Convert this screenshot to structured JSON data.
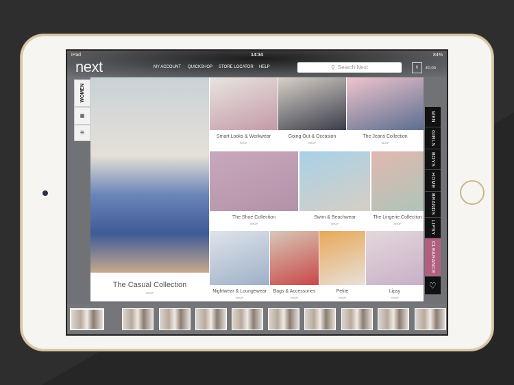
{
  "status": {
    "device": "iPad",
    "time": "14:34",
    "battery": "84%"
  },
  "header": {
    "logo": "next",
    "nav": [
      "MY ACCOUNT",
      "QUICKSHOP",
      "STORE LOCATOR",
      "HELP"
    ],
    "search_placeholder": "Search Next",
    "bag_count": "0",
    "bag_total": "£0.00"
  },
  "left_tabs": {
    "women": "WOMEN",
    "grid_icon": "grid-icon",
    "menu_icon": "menu-icon"
  },
  "hero": {
    "label": "The Casual Collection",
    "shop": "SHOP"
  },
  "tiles": [
    {
      "label": "Smart Looks & Workwear",
      "shop": "SHOP"
    },
    {
      "label": "Going Out & Occasion",
      "shop": "SHOP"
    },
    {
      "label": "The Jeans Collection",
      "shop": "SHOP"
    },
    {
      "label": "The Shoe Collection",
      "shop": "SHOP"
    },
    {
      "label": "Swim & Beachwear",
      "shop": "SHOP"
    },
    {
      "label": "The Lingerie Collection",
      "shop": "SHOP"
    },
    {
      "label": "Nightwear & Loungewear",
      "shop": "SHOP"
    },
    {
      "label": "Bags & Accessories",
      "shop": "SHOP"
    },
    {
      "label": "Petite",
      "shop": "SHOP"
    },
    {
      "label": "Lipsy",
      "shop": "SHOP"
    }
  ],
  "right_tabs": [
    "MEN",
    "GIRLS",
    "BOYS",
    "HOME",
    "BRANDS",
    "LIPSY",
    "CLEARANCE"
  ],
  "colors": {
    "clearance": "#b0607e",
    "tab_bg": "#111111"
  }
}
